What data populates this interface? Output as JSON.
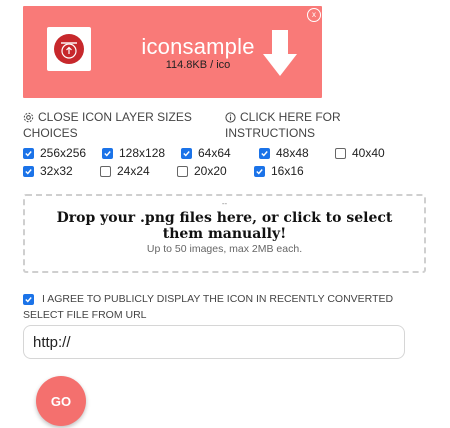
{
  "result": {
    "name": "iconsample",
    "meta": "114.8KB / ico",
    "close_glyph": "x",
    "accent": "#f97a78"
  },
  "options": {
    "sizes_link": "CLOSE ICON LAYER SIZES CHOICES",
    "instructions_link": "CLICK HERE FOR INSTRUCTIONS"
  },
  "sizes": [
    {
      "label": "256x256",
      "checked": true
    },
    {
      "label": "128x128",
      "checked": true
    },
    {
      "label": "64x64",
      "checked": true
    },
    {
      "label": "48x48",
      "checked": true
    },
    {
      "label": "40x40",
      "checked": false
    },
    {
      "label": "32x32",
      "checked": true
    },
    {
      "label": "24x24",
      "checked": false
    },
    {
      "label": "20x20",
      "checked": false
    },
    {
      "label": "16x16",
      "checked": true
    }
  ],
  "dropzone": {
    "dash": "--",
    "main": "Drop your .png files here, or click to select them manually!",
    "sub": "Up to 50 images, max 2MB each."
  },
  "agree": {
    "label": "I AGREE TO PUBLICLY DISPLAY THE ICON IN RECENTLY CONVERTED",
    "checked": true
  },
  "url": {
    "label": "SELECT FILE FROM URL",
    "value": "http://"
  },
  "go_label": "GO"
}
